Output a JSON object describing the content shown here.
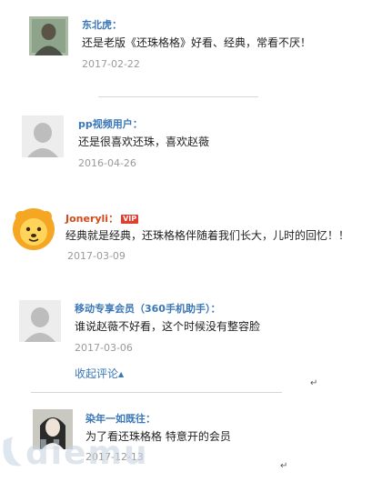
{
  "comments": [
    {
      "name": "东北虎：",
      "text": "还是老版《还珠格格》好看、经典，常看不厌！",
      "date": "2017-02-22",
      "avatar": "vintage-portrait-photo"
    },
    {
      "name": "pp视频用户：",
      "text": "还是很喜欢还珠，喜欢赵薇",
      "date": "2016-04-26",
      "avatar": "default-user-silhouette"
    },
    {
      "name": "Joneryli：",
      "vip": "VIP",
      "text": "经典就是经典，还珠格格伴随着我们长大，儿时的回忆！！",
      "date": "2017-03-09",
      "avatar": "lion-mascot"
    },
    {
      "name": "移动专享会员（360手机助手）：",
      "text": "谁说赵薇不好看，这个时候没有整容脸",
      "date": "2017-03-06",
      "avatar": "default-user-silhouette"
    },
    {
      "name": "染年一如既往：",
      "text": "为了看还珠格格 特意开的会员",
      "date": "2017-12-13",
      "avatar": "woman-portrait-photo"
    }
  ],
  "collapse_label": "收起评论",
  "return_mark": "↵",
  "watermark": "diemu",
  "colors": {
    "name": "#3a77b7",
    "date": "#9a9a9a",
    "vip": "#e23b2f",
    "lion": "#f5a623"
  }
}
